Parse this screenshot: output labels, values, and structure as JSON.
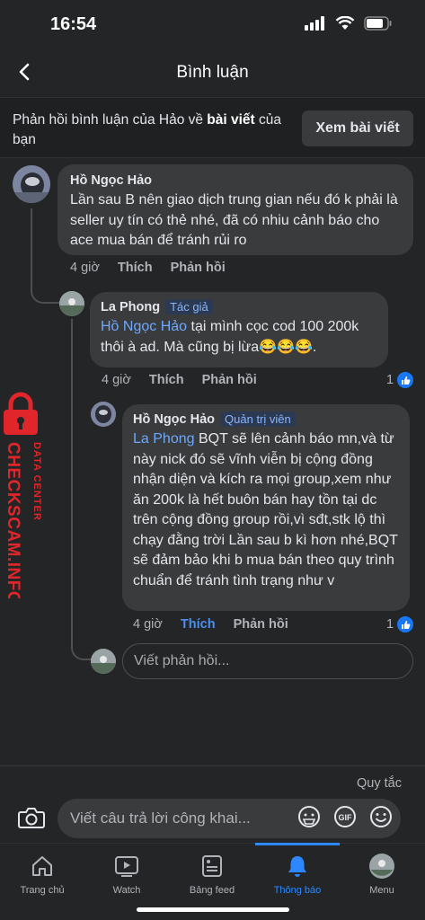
{
  "status": {
    "time": "16:54"
  },
  "nav": {
    "title": "Bình luận"
  },
  "context": {
    "text_before": "Phản hồi bình luận của Hảo về ",
    "text_bold": "bài viết",
    "text_after": " của bạn",
    "button": "Xem bài viết"
  },
  "comments": [
    {
      "author": "Hồ Ngọc Hảo",
      "badge": "",
      "mention": "",
      "text": "Lần sau B nên giao dịch trung gian nếu đó k phải là seller uy tín có thẻ nhé, đã có nhiu cảnh báo cho ace mua bán để tránh rủi ro",
      "time": "4 giờ",
      "like": "Thích",
      "reply": "Phản hồi",
      "reactions": ""
    },
    {
      "author": "La Phong",
      "badge": "Tác giả",
      "mention": "Hồ Ngọc Hảo",
      "text": " tại mình cọc cod 100 200k thôi à ad. Mà cũng bị lừa😂😂😂.",
      "time": "4 giờ",
      "like": "Thích",
      "reply": "Phản hồi",
      "reactions": "1"
    },
    {
      "author": "Hồ Ngọc Hảo",
      "badge": "Quản trị viên",
      "mention": "La Phong",
      "text": " BQT sẽ  lên  cảnh báo mn,và từ này nick đó sẽ vĩnh viễn bị cộng đồng nhận diện và kích ra mọi group,xem như ăn 200k là hết  buôn bán hay tồn tại dc trên cộng đồng group rồi,vì sđt,stk lộ thì chạy đằng trời Lần sau b kì hơn nhé,BQT sẽ đảm bảo khi b mua bán theo quy trình chuẩn để tránh tình trạng như v",
      "time": "4 giờ",
      "like": "Thích",
      "reply": "Phản hồi",
      "reactions": "1"
    }
  ],
  "reply_box": {
    "placeholder": "Viết phản hồi..."
  },
  "watermark": {
    "line1": "DATA CENTER",
    "line2": "CHECKSCAM.INFO"
  },
  "composer": {
    "rules": "Quy tắc",
    "placeholder": "Viết câu trả lời công khai...",
    "gif": "GIF"
  },
  "tabs": [
    {
      "label": "Trang chủ",
      "icon": "home-icon"
    },
    {
      "label": "Watch",
      "icon": "watch-icon"
    },
    {
      "label": "Bảng feed",
      "icon": "feed-icon"
    },
    {
      "label": "Thông báo",
      "icon": "bell-icon",
      "active": true
    },
    {
      "label": "Menu",
      "icon": "avatar-icon"
    }
  ],
  "colors": {
    "background": "#242526",
    "bubble": "#3a3b3c",
    "accent": "#2d88ff",
    "mention": "#6ea8fe",
    "watermark": "#e0262b"
  }
}
